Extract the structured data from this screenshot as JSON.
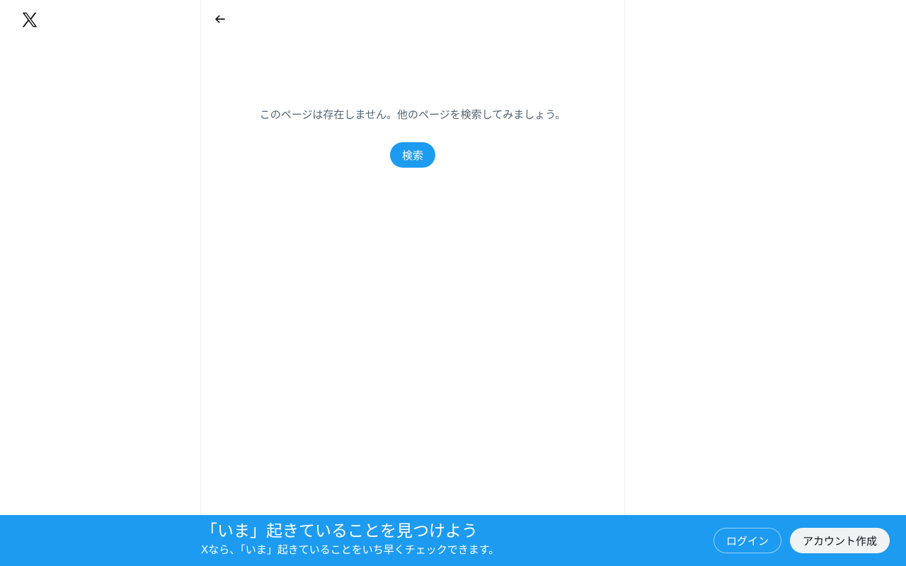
{
  "logo": {
    "icon": "x-logo-icon"
  },
  "header": {
    "back_icon": "arrow-left-icon"
  },
  "main": {
    "not_found_message": "このページは存在しません。他のページを検索してみましょう。",
    "search_button_label": "検索"
  },
  "bottom_bar": {
    "title": "「いま」起きていることを見つけよう",
    "subtitle": "Xなら、「いま」起きていることをいち早くチェックできます。",
    "login_label": "ログイン",
    "signup_label": "アカウント作成"
  },
  "colors": {
    "accent": "#1d9bf0",
    "text_secondary": "#536471",
    "border": "#eff3f4"
  }
}
